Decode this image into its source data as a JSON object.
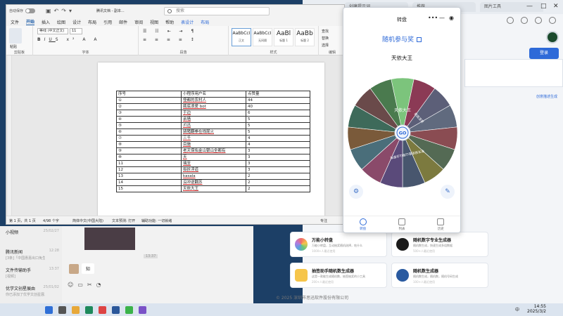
{
  "word": {
    "autosave_label": "自动保存",
    "doc_name": "腾讯文档 - 副本...",
    "search_placeholder": "搜索",
    "tabs": [
      "文件",
      "开始",
      "插入",
      "绘图",
      "设计",
      "布局",
      "引用",
      "邮件",
      "审阅",
      "视图",
      "帮助",
      "表设计",
      "布局"
    ],
    "active_tab_index": 1,
    "ribbon": {
      "paste": "粘贴",
      "clipboard": "剪贴板",
      "font_name": "等线 (中文正文)",
      "font_size": "11",
      "font_group": "字体",
      "paragraph_group": "段落",
      "styles_group": "样式",
      "styles": [
        {
          "preview": "AaBbCcI",
          "name": "正文"
        },
        {
          "preview": "AaBbCcI",
          "name": "无间隔"
        },
        {
          "preview": "AaBl",
          "name": "标题 1"
        },
        {
          "preview": "AaBb",
          "name": "标题 2"
        }
      ],
      "edit_find": "查找",
      "edit_replace": "替换",
      "edit_select": "选择",
      "edit_group": "编辑"
    },
    "table": [
      [
        "序号",
        "小程序用户名",
        "点赞量"
      ],
      [
        "①",
        "怪都的农村人",
        "44"
      ],
      [
        "②",
        "瓶底浪爱 bot",
        "40"
      ],
      [
        "③",
        "于边",
        "6"
      ],
      [
        "④",
        "余墙",
        "5"
      ],
      [
        "⑤",
        "爪迅",
        "5"
      ],
      [
        "⑥",
        "骑猪翻拳在线尾火",
        "5"
      ],
      [
        "⑦",
        "三千",
        "4"
      ],
      [
        "⑧",
        "目施",
        "4"
      ],
      [
        "⑨",
        "老天保佑金山银山全都有",
        "3"
      ],
      [
        "⑩",
        "天",
        "3"
      ],
      [
        "11",
        "璃至",
        "3"
      ],
      [
        "12",
        "拟折浮道",
        "3"
      ],
      [
        "13",
        "kasala",
        "2"
      ],
      [
        "14",
        "沿冲逆翻苏",
        "2"
      ],
      [
        "15",
        "天依大王",
        "2"
      ]
    ],
    "status": {
      "page": "第 1 页，共 1 页",
      "words": "4/98 个字",
      "lang": "简体中文(中国大陆)",
      "predict": "文本预测: 打开",
      "access": "辅助功能: 一切就绪",
      "focus": "专注"
    }
  },
  "panel": {
    "title": "转盘",
    "feature_link": "随机参与奖",
    "result": "天依大王",
    "center_label": "GO",
    "nav": [
      "转盘",
      "列表",
      "历史"
    ],
    "colors": [
      "#7cc47c",
      "#8b3a55",
      "#5c5f78",
      "#606a7e",
      "#8a4c52",
      "#546a54",
      "#7c7a3f",
      "#48566e",
      "#5a4a7a",
      "#8a4a6a",
      "#4a6e7a",
      "#7a5a3a",
      "#3e6a5a",
      "#6a4a4a",
      "#4a7a4e"
    ],
    "wheel_labels": [
      "天依大王",
      "",
      "瓶底浪爱",
      "",
      "",
      "",
      "",
      "老天保佑金山银山全都有",
      "",
      "",
      "",
      "",
      "",
      "",
      ""
    ]
  },
  "browser": {
    "tabs": [
      "创建提示词",
      "推荐",
      "图片工具"
    ],
    "login": "登录",
    "promo_link": "创意描述生成",
    "cards": [
      {
        "title": "万能小转盘",
        "desc": "万能小转盘，互动抽奖随机选择，吃什么",
        "stat": "1000+人最近使用",
        "color": "#f0a860"
      },
      {
        "title": "随机数字专业生成器",
        "desc": "随机数生成，快速生成多组数据",
        "stat": "500+人最近使用",
        "color": "#1b1b1b"
      },
      {
        "title": "抽签助手随机数生成器",
        "desc": "这是一款能生成随机数，抽签抽奖的小工具",
        "stat": "200+人最近使用",
        "color": "#f6c54a"
      },
      {
        "title": "随机数生成器",
        "desc": "随机数生成，随机数，随机号码生成",
        "stat": "100+人最近使用",
        "color": "#2a5aa0"
      }
    ],
    "footer": "© 2025 深圳市思迅软件股份有限公司"
  },
  "chat": {
    "items": [
      {
        "name": "小视频",
        "msg": "",
        "time": "25/02/27"
      },
      {
        "name": "腾讯新闻",
        "msg": "[3条]「中国惠嘉出口免生...",
        "time": "12:28"
      },
      {
        "name": "文件传输助手",
        "msg": "[视频]",
        "time": "13:37"
      },
      {
        "name": "优学文创星展由",
        "msg": "你已添加了优学文创星展...",
        "time": "25/01/02"
      }
    ],
    "time_tag": "13:37",
    "bubble": "知"
  },
  "taskbar": {
    "time": "14:55",
    "date": "2025/3/2",
    "lang": "中"
  }
}
